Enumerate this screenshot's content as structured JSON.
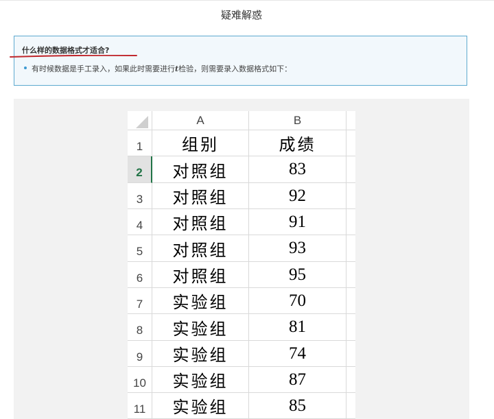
{
  "header": {
    "title": "疑难解惑"
  },
  "qa": {
    "question": "什么样的数据格式才适合?",
    "answer_prefix": "有时候数据是手工录入，如果此时需要进行",
    "answer_t": "t",
    "answer_suffix": "检验，则需要录入数据格式如下："
  },
  "sheet": {
    "columns": [
      "A",
      "B"
    ],
    "header_row": {
      "row": "1",
      "a": "组别",
      "b": "成绩"
    },
    "rows": [
      {
        "row": "2",
        "a": "对照组",
        "b": "83"
      },
      {
        "row": "3",
        "a": "对照组",
        "b": "92"
      },
      {
        "row": "4",
        "a": "对照组",
        "b": "91"
      },
      {
        "row": "5",
        "a": "对照组",
        "b": "93"
      },
      {
        "row": "6",
        "a": "对照组",
        "b": "95"
      },
      {
        "row": "7",
        "a": "实验组",
        "b": "70"
      },
      {
        "row": "8",
        "a": "实验组",
        "b": "81"
      },
      {
        "row": "9",
        "a": "实验组",
        "b": "74"
      },
      {
        "row": "10",
        "a": "实验组",
        "b": "87"
      },
      {
        "row": "11",
        "a": "实验组",
        "b": "85"
      }
    ],
    "active_row": "2"
  },
  "colors": {
    "box_border": "#5da9cf",
    "box_bg": "#f2f8fc",
    "underline": "#c0282d",
    "excel_green": "#217346"
  }
}
